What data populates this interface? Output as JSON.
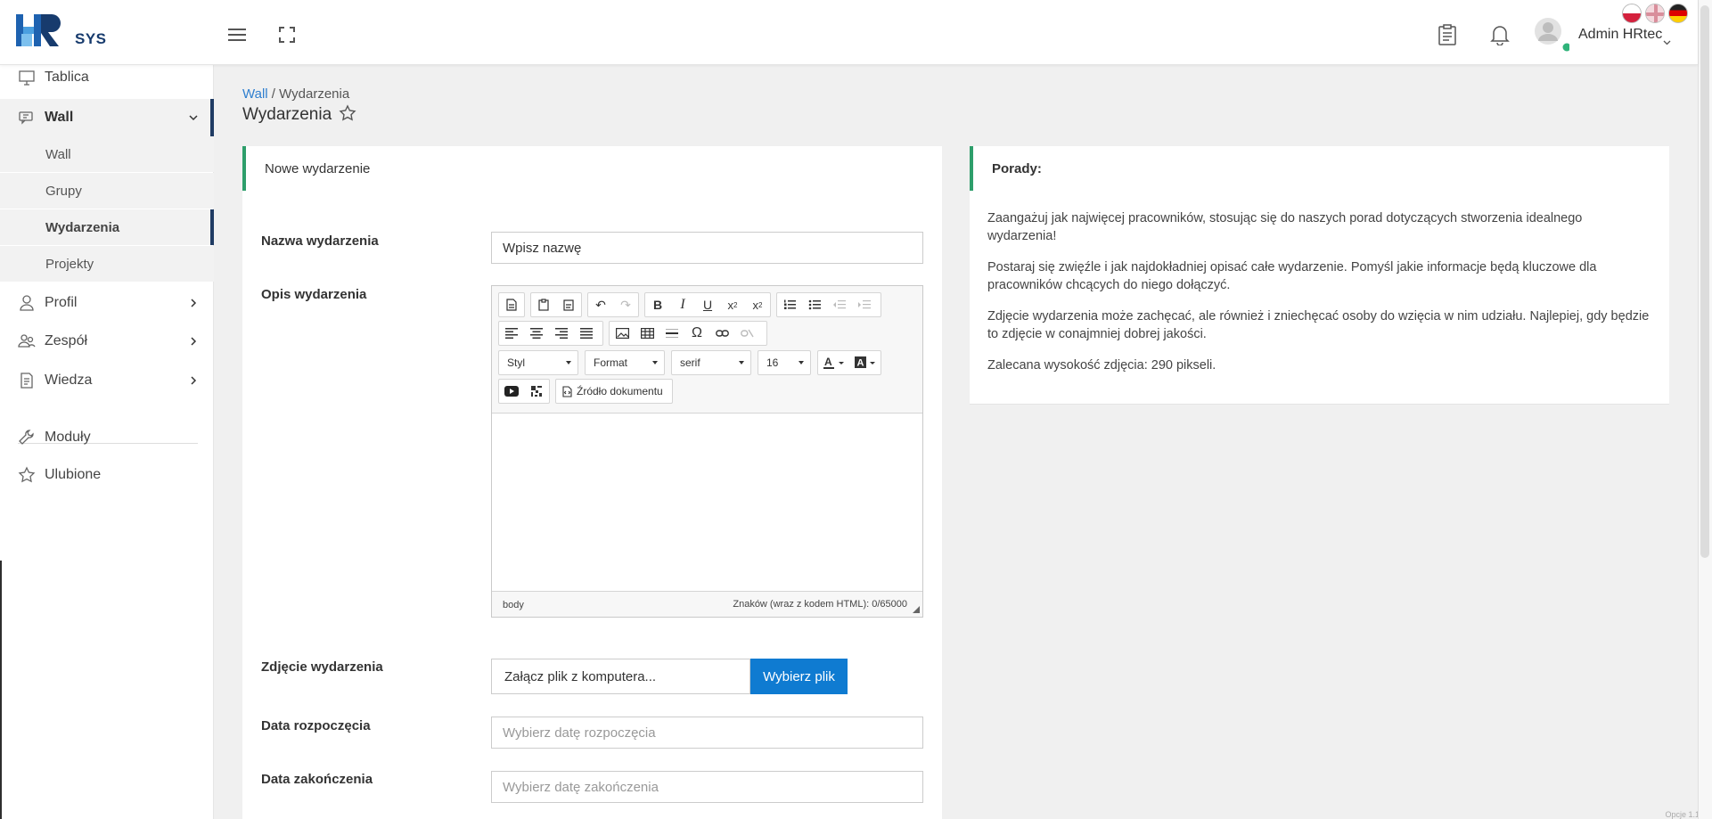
{
  "header": {
    "logo_text": "SYS",
    "user_name": "Admin HRtec"
  },
  "sidebar": {
    "items": [
      {
        "label": "Tablica"
      },
      {
        "label": "Wall"
      },
      {
        "label": "Profil"
      },
      {
        "label": "Zespół"
      },
      {
        "label": "Wiedza"
      },
      {
        "label": "Moduły"
      },
      {
        "label": "Ulubione"
      }
    ],
    "sub_items": [
      {
        "label": "Wall"
      },
      {
        "label": "Grupy"
      },
      {
        "label": "Wydarzenia"
      },
      {
        "label": "Projekty"
      }
    ]
  },
  "breadcrumb": {
    "parent": "Wall",
    "separator": " / ",
    "current": "Wydarzenia"
  },
  "page_title": "Wydarzenia",
  "form": {
    "panel_title": "Nowe wydarzenie",
    "name_label": "Nazwa wydarzenia",
    "name_placeholder": "Wpisz nazwę",
    "desc_label": "Opis wydarzenia",
    "editor": {
      "style_combo": "Styl",
      "format_combo": "Format",
      "font_combo": "serif",
      "size_combo": "16",
      "source_button": "Źródło dokumentu",
      "status_path": "body",
      "char_count": "Znaków (wraz z kodem HTML): 0/65000"
    },
    "photo_label": "Zdjęcie wydarzenia",
    "photo_placeholder": "Załącz plik z komputera...",
    "photo_button": "Wybierz plik",
    "start_label": "Data rozpoczęcia",
    "start_placeholder": "Wybierz datę rozpoczęcia",
    "end_label": "Data zakończenia",
    "end_placeholder": "Wybierz datę zakończenia"
  },
  "tips": {
    "title": "Porady:",
    "paragraphs": [
      "Zaangażuj jak najwięcej pracowników, stosując się do naszych porad dotyczących stworzenia idealnego wydarzenia!",
      "Postaraj się zwięźle i jak najdokładniej opisać całe wydarzenie. Pomyśl jakie informacje będą kluczowe dla pracowników chcących do niego dołączyć.",
      "Zdjęcie wydarzenia może zachęcać, ale również i zniechęcać osoby do wzięcia w nim udziału. Najlepiej, gdy będzie to zdjęcie w conajmniej dobrej jakości.",
      "Zalecana wysokość zdjęcia: 290 pikseli."
    ]
  },
  "footer": {
    "options": "Opcje 1.1"
  },
  "colors": {
    "accent": "#2e9e6b",
    "primary": "#0f7bd1",
    "nav_active": "#1f3b63",
    "link": "#2f7fcf"
  }
}
